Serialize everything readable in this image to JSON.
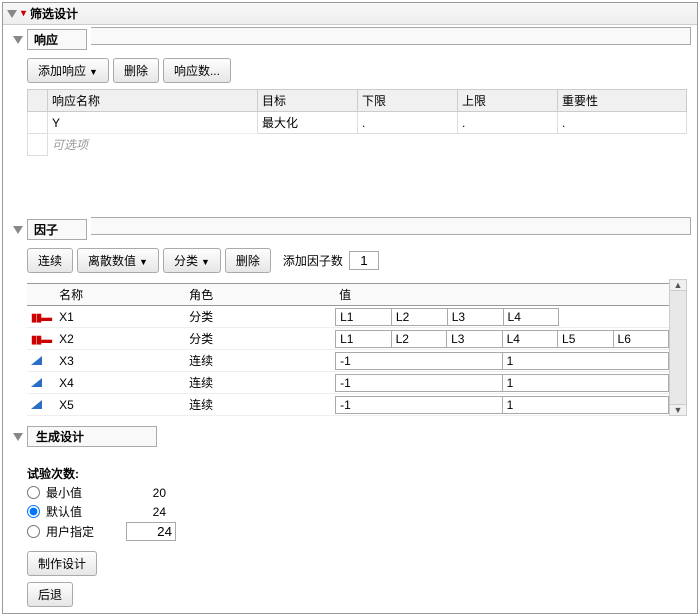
{
  "main_title": "筛选设计",
  "response": {
    "title": "响应",
    "btn_add": "添加响应",
    "btn_delete": "删除",
    "btn_count": "响应数...",
    "headers": {
      "name": "响应名称",
      "goal": "目标",
      "lower": "下限",
      "upper": "上限",
      "importance": "重要性"
    },
    "rows": [
      {
        "name": "Y",
        "goal": "最大化",
        "lower": ".",
        "upper": ".",
        "importance": "."
      }
    ],
    "placeholder": "可选项"
  },
  "factors": {
    "title": "因子",
    "btn_continuous": "连续",
    "btn_discrete": "离散数值",
    "btn_categorical": "分类",
    "btn_delete": "删除",
    "add_label": "添加因子数",
    "add_count": "1",
    "headers": {
      "name": "名称",
      "role": "角色",
      "values": "值"
    },
    "rows": [
      {
        "icon": "bar",
        "name": "X1",
        "role": "分类",
        "values": [
          "L1",
          "L2",
          "L3",
          "L4"
        ]
      },
      {
        "icon": "bar",
        "name": "X2",
        "role": "分类",
        "values": [
          "L1",
          "L2",
          "L3",
          "L4",
          "L5",
          "L6"
        ]
      },
      {
        "icon": "tri",
        "name": "X3",
        "role": "连续",
        "values": [
          "-1",
          "1"
        ]
      },
      {
        "icon": "tri",
        "name": "X4",
        "role": "连续",
        "values": [
          "-1",
          "1"
        ]
      },
      {
        "icon": "tri",
        "name": "X5",
        "role": "连续",
        "values": [
          "-1",
          "1"
        ]
      }
    ]
  },
  "generate": {
    "title": "生成设计",
    "runs_label": "试验次数:",
    "min": {
      "label": "最小值",
      "value": "20"
    },
    "default": {
      "label": "默认值",
      "value": "24"
    },
    "user": {
      "label": "用户指定",
      "value": "24"
    },
    "btn_make": "制作设计",
    "btn_back": "后退"
  }
}
